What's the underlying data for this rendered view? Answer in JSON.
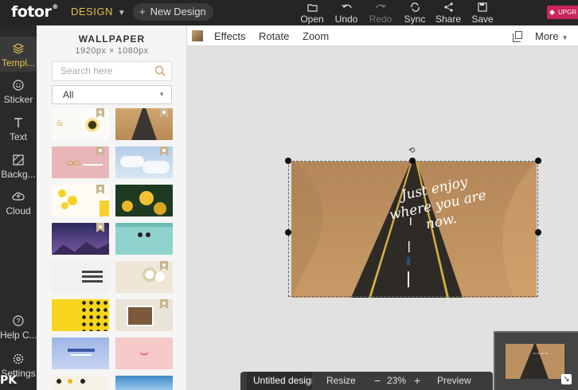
{
  "topbar": {
    "logo": "fotor",
    "logo_mark": "®",
    "design_menu": "DESIGN",
    "new_design": "New Design",
    "buttons": [
      {
        "label": "Open",
        "icon": "open-icon",
        "enabled": true
      },
      {
        "label": "Undo",
        "icon": "undo-icon",
        "enabled": true
      },
      {
        "label": "Redo",
        "icon": "redo-icon",
        "enabled": false
      },
      {
        "label": "Sync",
        "icon": "sync-icon",
        "enabled": true
      },
      {
        "label": "Share",
        "icon": "share-icon",
        "enabled": true
      },
      {
        "label": "Save",
        "icon": "save-icon",
        "enabled": true
      }
    ],
    "upgrade": "UPGR"
  },
  "sidebar": {
    "items": [
      {
        "label": "Templ...",
        "icon": "layers-icon",
        "active": true
      },
      {
        "label": "Sticker",
        "icon": "smile-icon",
        "active": false
      },
      {
        "label": "Text",
        "icon": "text-icon",
        "active": false
      },
      {
        "label": "Backg...",
        "icon": "background-icon",
        "active": false
      },
      {
        "label": "Cloud",
        "icon": "cloud-icon",
        "active": false
      },
      {
        "label": "Help C...",
        "icon": "help-icon",
        "active": false
      },
      {
        "label": "Settings",
        "icon": "settings-icon",
        "active": false
      }
    ]
  },
  "panel": {
    "title": "WALLPAPER",
    "size": "1920px × 1080px",
    "search_placeholder": "Search here",
    "filter_value": "All"
  },
  "toolbar2": {
    "effects": "Effects",
    "rotate": "Rotate",
    "zoom": "Zoom",
    "more": "More"
  },
  "canvas": {
    "quote_line1": "Just enjoy",
    "quote_line2": "where you are",
    "quote_line3": "now."
  },
  "bottombar": {
    "filename": "Untitled design",
    "resize": "Resize",
    "minus": "−",
    "zoom": "23%",
    "plus": "+",
    "preview": "Preview"
  },
  "watermark": "PK"
}
